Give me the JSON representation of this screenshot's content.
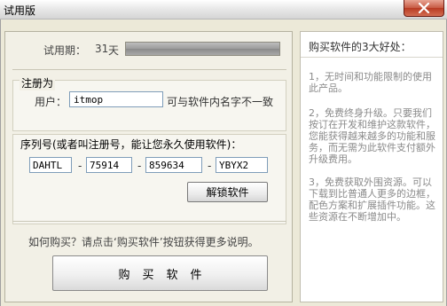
{
  "window": {
    "title": "试用版"
  },
  "trial": {
    "label": "试用期：",
    "days": "31",
    "unit": "天",
    "progress": 1.0
  },
  "registration": {
    "title": "注册为",
    "user_label": "用户：",
    "user_value": "itmop",
    "user_hint": "可与软件内名字不一致"
  },
  "serial": {
    "title": "序列号(或者叫注册号，能让您永久使用软件)：",
    "parts": [
      "DAHTL",
      "75914",
      "859634",
      "YBYX2"
    ],
    "separator": "-",
    "unlock_label": "解锁软件"
  },
  "buy": {
    "hint": "如何购买？请点击‘购买软件’按钮获得更多说明。",
    "button_label": "购买软件"
  },
  "info": {
    "title": "购买软件的3大好处：",
    "items": [
      "1，无时间和功能限制的使用此产品。",
      "2，免费终身升级。只要我们按订在开发和维护这款软件，您能获得越来越多的功能和服务，而无需为此软件支付额外升级费用。",
      "3，免费获取外围资源。可以下载到比普通人更多的边框，配色方案和扩展插件功能。这些资源在不断增加中。"
    ]
  },
  "colors": {
    "close_button": "#c75a43",
    "progress_fill": "#9c9c9c",
    "info_text": "#8a8a8a"
  }
}
